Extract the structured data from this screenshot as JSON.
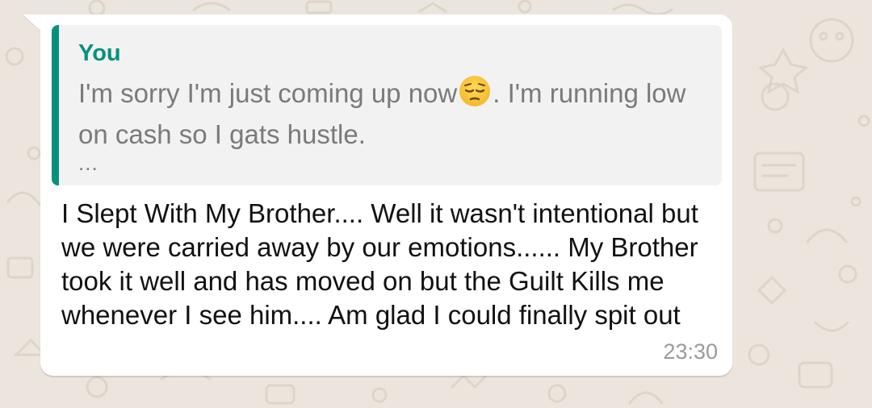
{
  "quote": {
    "author": "You",
    "text_before_emoji": "I'm sorry I'm just coming up now",
    "emoji": "pensive-face",
    "text_after_emoji": ". I'm running low on cash so I gats hustle.",
    "more": "..."
  },
  "message": {
    "text": "I Slept With My Brother.... Well it wasn't intentional but we were carried away by our emotions...... My Brother took it well and has moved on but the Guilt Kills me whenever I see him.... Am glad I could finally spit out",
    "time": "23:30"
  },
  "colors": {
    "wallpaper": "#ece5dd",
    "bubble": "#ffffff",
    "quote_accent": "#06917c",
    "quote_background": "#f2f2f2"
  }
}
